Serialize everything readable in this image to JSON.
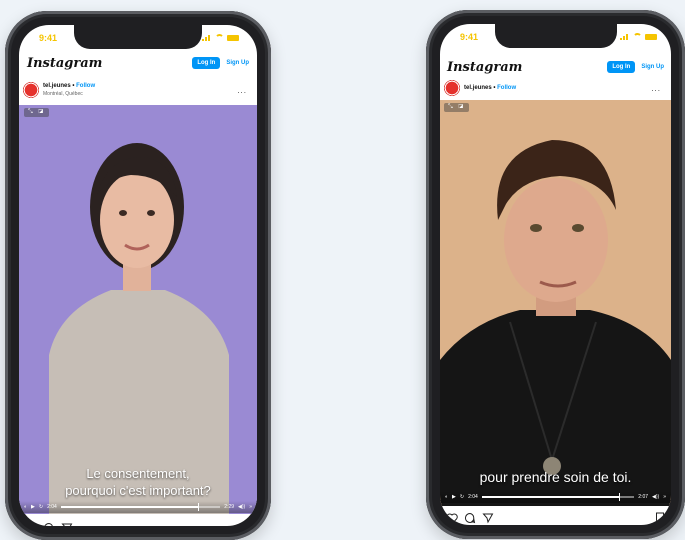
{
  "phones": [
    {
      "status_time": "9:41",
      "app_logo": "Instagram",
      "login_label": "Log In",
      "signup_label": "Sign Up",
      "account": "tel.jeunes",
      "follow_label": "Follow",
      "location": "Montréal, Québec",
      "more_label": "...",
      "caption_line1": "Le consentement,",
      "caption_line2": "pourquoi c'est important?",
      "time_elapsed": "2:04",
      "time_total": "2:29",
      "progress": 0.86
    },
    {
      "status_time": "9:41",
      "app_logo": "Instagram",
      "login_label": "Log In",
      "signup_label": "Sign Up",
      "account": "tel.jeunes",
      "follow_label": "Follow",
      "more_label": "...",
      "caption_line1": "pour prendre soin de toi.",
      "time_elapsed": "2:04",
      "time_total": "2:07",
      "progress": 0.9
    }
  ],
  "colors": {
    "accent": "#0095f6",
    "status": "#f5c400",
    "left_bg": "#9a8ad3",
    "right_bg": "#dcb28a",
    "page_bg": "#eef3f8"
  }
}
